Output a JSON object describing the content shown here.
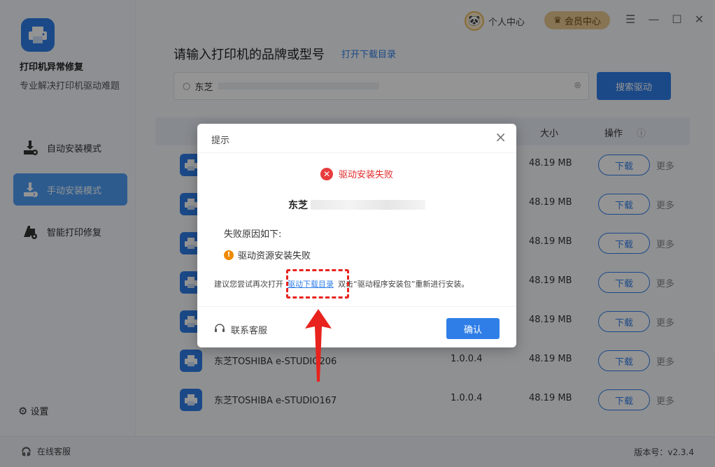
{
  "app": {
    "name": "打印机异常修复",
    "subtitle": "专业解决打印机驱动难题"
  },
  "sidebar": {
    "items": [
      {
        "label": "自动安装模式",
        "active": false
      },
      {
        "label": "手动安装模式",
        "active": true
      },
      {
        "label": "智能打印修复",
        "active": false
      }
    ],
    "settings_label": "设置"
  },
  "topbar": {
    "user_center": "个人中心",
    "vip_center": "会员中心",
    "menu_icon": "menu-icon",
    "min_icon": "minimize-icon",
    "max_icon": "maximize-icon",
    "close_icon": "close-icon"
  },
  "main": {
    "headline": "请输入打印机的品牌或型号",
    "open_dir": "打开下载目录",
    "search_value": "东芝",
    "search_button": "搜索驱动"
  },
  "table": {
    "headers": {
      "size": "大小",
      "operation": "操作"
    },
    "rows": [
      {
        "name": "",
        "version": "",
        "size": "48.19 MB",
        "download": "下载",
        "more": "更多"
      },
      {
        "name": "",
        "version": "",
        "size": "48.19 MB",
        "download": "下载",
        "more": "更多"
      },
      {
        "name": "",
        "version": "",
        "size": "48.19 MB",
        "download": "下载",
        "more": "更多"
      },
      {
        "name": "",
        "version": "",
        "size": "48.19 MB",
        "download": "下载",
        "more": "更多"
      },
      {
        "name": "",
        "version": "",
        "size": "48.19 MB",
        "download": "下载",
        "more": "更多"
      },
      {
        "name": "东芝TOSHIBA e-STUDIO206",
        "version": "1.0.0.4",
        "size": "48.19 MB",
        "download": "下载",
        "more": "更多"
      },
      {
        "name": "东芝TOSHIBA e-STUDIO167",
        "version": "1.0.0.4",
        "size": "48.19 MB",
        "download": "下载",
        "more": "更多"
      }
    ]
  },
  "dialog": {
    "title": "提示",
    "status": "驱动安装失败",
    "brand": "东芝",
    "reason_label": "失败原因如下:",
    "reason": "驱动资源安装失败",
    "suggest_pre": "建议您尝试再次打开",
    "suggest_link": "驱动下载目录",
    "suggest_post": "双击“驱动程序安装包”重新进行安装。",
    "contact": "联系客服",
    "confirm": "确认"
  },
  "statusbar": {
    "online_service": "在线客服",
    "version": "版本号：v2.3.4"
  },
  "colors": {
    "accent": "#2f7ee8",
    "error": "#e02a2a",
    "warning": "#f08a00",
    "vip": "#e9c98f"
  }
}
